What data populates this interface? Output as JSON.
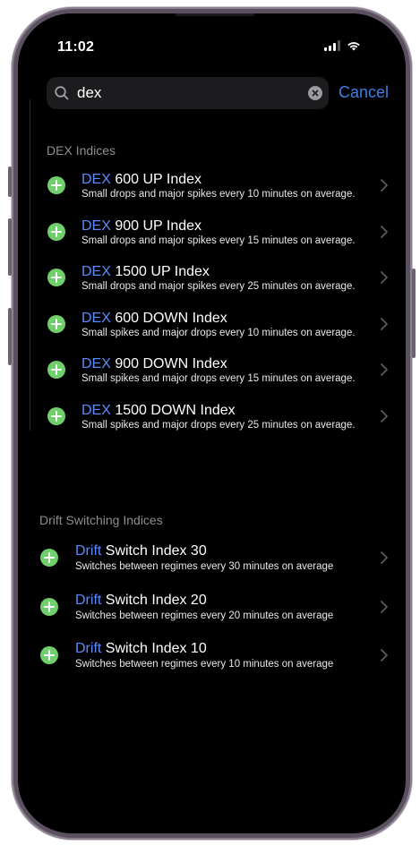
{
  "status": {
    "time": "11:02"
  },
  "search": {
    "value": "dex",
    "cancel_label": "Cancel"
  },
  "sections": [
    {
      "title": "DEX Indices",
      "items": [
        {
          "highlight": "DEX",
          "rest": " 600 UP Index",
          "subtitle": "Small drops and major spikes every 10 minutes on average."
        },
        {
          "highlight": "DEX",
          "rest": " 900 UP Index",
          "subtitle": "Small drops and major spikes every 15 minutes on average."
        },
        {
          "highlight": "DEX",
          "rest": " 1500 UP Index",
          "subtitle": "Small drops and major spikes every 25 minutes on average."
        },
        {
          "highlight": "DEX",
          "rest": " 600 DOWN Index",
          "subtitle": "Small spikes and major drops every 10 minutes on average."
        },
        {
          "highlight": "DEX",
          "rest": " 900 DOWN Index",
          "subtitle": "Small spikes and major drops every 15 minutes on average."
        },
        {
          "highlight": "DEX",
          "rest": " 1500 DOWN Index",
          "subtitle": "Small spikes and major drops every 25 minutes on average."
        }
      ]
    },
    {
      "title": "Drift Switching Indices",
      "items": [
        {
          "highlight": "Drift",
          "rest": " Switch Index 30",
          "subtitle": "Switches between regimes every 30 minutes on average"
        },
        {
          "highlight": "Drift",
          "rest": " Switch Index 20",
          "subtitle": "Switches between regimes every 20 minutes on average"
        },
        {
          "highlight": "Drift",
          "rest": " Switch Index 10",
          "subtitle": "Switches between regimes every 10 minutes on average"
        }
      ]
    }
  ],
  "colors": {
    "accent": "#5b8bff",
    "add_button": "#6fcf6a",
    "cancel": "#3d7fe6"
  }
}
